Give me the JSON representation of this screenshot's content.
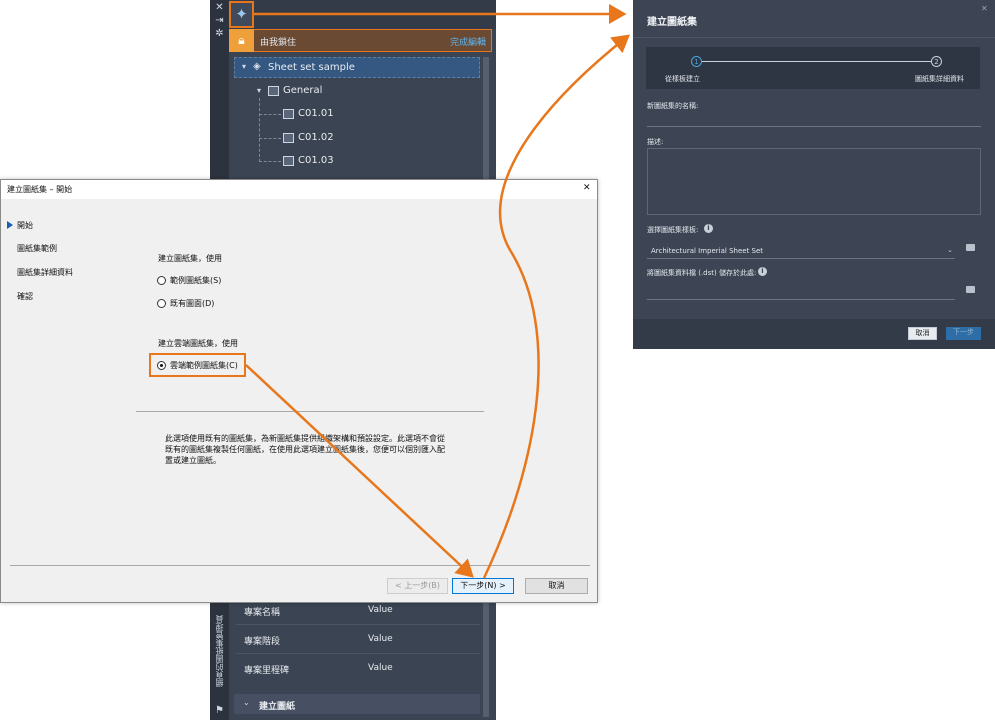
{
  "palette": {
    "locked_label": "由我鎖住",
    "finish_edit": "完成編輯",
    "tree": {
      "root": "Sheet set sample",
      "subset": "General",
      "sheets": [
        "C01.01",
        "C01.02",
        "C01.03"
      ]
    },
    "properties": [
      {
        "label": "專案名稱",
        "value": "Value"
      },
      {
        "label": "專案階段",
        "value": "Value"
      },
      {
        "label": "專案里程碑",
        "value": "Value"
      }
    ],
    "create_sheet": "建立圖紙",
    "vertical_title": "網頁的圖紙集管理員",
    "strip_icons": [
      "close-icon",
      "pin-icon",
      "settings-icon"
    ]
  },
  "classic_dialog": {
    "title": "建立圖紙集 – 開始",
    "close": "✕",
    "steps": [
      "開始",
      "圖紙集範例",
      "圖紙集詳細資料",
      "確認"
    ],
    "group1_label": "建立圖紙集，使用",
    "option_example": "範例圖紙集(S)",
    "option_existing": "既有圖面(D)",
    "group2_label": "建立雲端圖紙集，使用",
    "option_cloud": "雲端範例圖紙集(C)",
    "description": "此選項使用既有的圖紙集，為新圖紙集提供組織架構和預設設定。此選項不會從既有的圖紙集複製任何圖紙，在使用此選項建立圖紙集後，您便可以個別匯入配置或建立圖紙。",
    "btn_back": "< 上一步(B)",
    "btn_next": "下一步(N) >",
    "btn_cancel": "取消"
  },
  "modern_dialog": {
    "title": "建立圖紙集",
    "close": "✕",
    "step1_num": "1",
    "step1_label": "從樣板建立",
    "step2_num": "2",
    "step2_label": "圖紙集詳細資料",
    "name_label": "新圖紙集的名稱:",
    "desc_label": "描述:",
    "template_label": "選擇圖紙集樣板:",
    "template_value": "Architectural Imperial Sheet Set",
    "store_label": "將圖紙集資料檔 (.dst) 儲存於此處:",
    "btn_cancel": "取消",
    "btn_next": "下一步"
  },
  "colors": {
    "highlight": "#e8761b",
    "palette_bg": "#3b4453",
    "modern_bg": "#3d4554",
    "accent_blue": "#4aa3df"
  }
}
